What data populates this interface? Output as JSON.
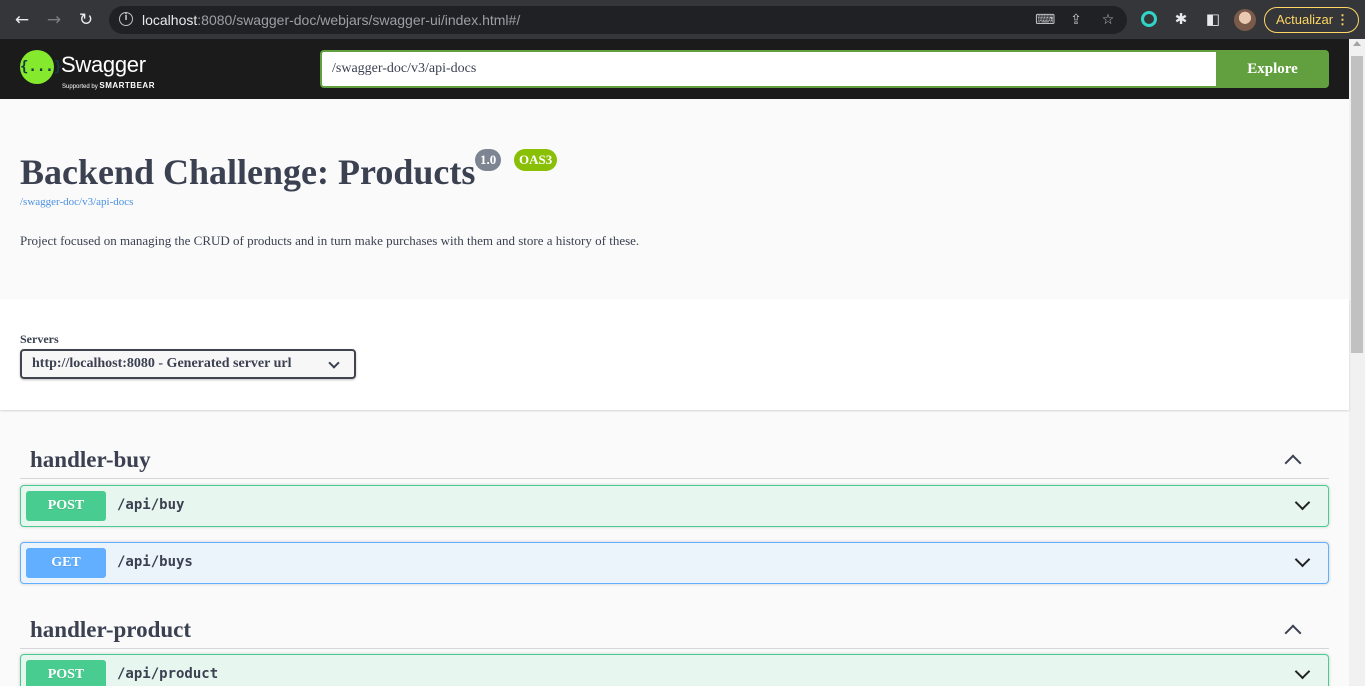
{
  "browser": {
    "url_host": "localhost",
    "url_rest": ":8080/swagger-doc/webjars/swagger-ui/index.html#/",
    "update_label": "Actualizar",
    "update_menu": "⋮",
    "back_icon": "←",
    "forward_icon": "→",
    "reload_icon": "↻"
  },
  "topbar": {
    "logo_glyph": "{...}",
    "logo_text": "Swagger",
    "logo_sub_prefix": "Supported by ",
    "logo_sub_brand": "SMARTBEAR",
    "spec_url": "/swagger-doc/v3/api-docs",
    "explore_label": "Explore"
  },
  "info": {
    "title": "Backend Challenge: Products",
    "version": "1.0",
    "oas": "OAS3",
    "spec_link": "/swagger-doc/v3/api-docs",
    "description": "Project focused on managing the CRUD of products and in turn make purchases with them and store a history of these."
  },
  "servers": {
    "label": "Servers",
    "selected": "http://localhost:8080 - Generated server url"
  },
  "tags": [
    {
      "name": "handler-buy",
      "operations": [
        {
          "method": "POST",
          "path": "/api/buy"
        },
        {
          "method": "GET",
          "path": "/api/buys"
        }
      ]
    },
    {
      "name": "handler-product",
      "operations": [
        {
          "method": "POST",
          "path": "/api/product"
        }
      ]
    }
  ],
  "colors": {
    "post": "#49cc90",
    "get": "#61affe",
    "explore": "#62a03f",
    "oas_badge": "#89bf04"
  }
}
